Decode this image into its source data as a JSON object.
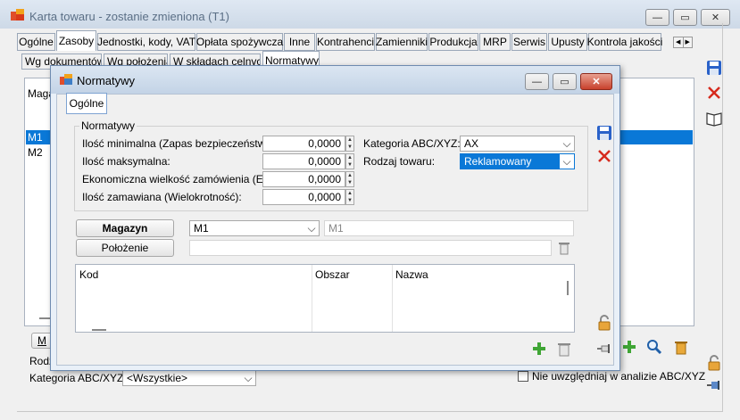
{
  "outer": {
    "title": "Karta towaru - zostanie zmieniona (T1)",
    "tabs": [
      "Ogólne",
      "Zasoby",
      "Jednostki, kody, VAT",
      "Opłata spożywcza",
      "Inne",
      "Kontrahenci",
      "Zamienniki",
      "Produkcja",
      "MRP",
      "Serwis",
      "Upusty",
      "Kontrola jakości"
    ],
    "active_tab": "Zasoby",
    "subtabs": [
      "Wg dokumentów",
      "Wg położenia",
      "W składach celnych",
      "Normatywy"
    ],
    "active_subtab": "Normatywy",
    "list_header": "Magazyn",
    "list_rows": [
      "M1",
      "M2"
    ],
    "selected_row": "M1",
    "bottom_button_label": "M",
    "rodz_label": "Rodz",
    "kategoria_label": "Kategoria ABC/XYZ:",
    "kategoria_value": "<Wszystkie>",
    "exclude_checkbox_label": "Nie uwzględniaj w analizie ABC/XYZ",
    "exclude_checked": false
  },
  "dialog": {
    "title": "Normatywy",
    "tab": "Ogólne",
    "group_title": "Normatywy",
    "fields": [
      {
        "label": "Ilość minimalna (Zapas bezpieczeństwa):",
        "value": "0,0000"
      },
      {
        "label": "Ilość maksymalna:",
        "value": "0,0000"
      },
      {
        "label": "Ekonomiczna wielkość zamówienia (EOQ):",
        "value": "0,0000"
      },
      {
        "label": "Ilość zamawiana (Wielokrotność):",
        "value": "0,0000"
      }
    ],
    "kategoria_label": "Kategoria ABC/XYZ:",
    "kategoria_value": "AX",
    "rodzaj_label": "Rodzaj towaru:",
    "rodzaj_value": "Reklamowany",
    "magazyn_button": "Magazyn",
    "magazyn_value": "M1",
    "magazyn_name": "M1",
    "polozenie_button": "Położenie",
    "polozenie_value": "",
    "table_columns": [
      "Kod",
      "Obszar",
      "Nazwa"
    ]
  },
  "colors": {
    "selection": "#0a78d7",
    "save": "#2a62c9",
    "delete": "#d62a1d",
    "add": "#3fa535"
  },
  "icons": [
    "app-icon",
    "minimize-icon",
    "maximize-icon",
    "close-icon",
    "save-icon",
    "delete-icon",
    "book-icon",
    "lock-icon",
    "pin-icon",
    "add-icon",
    "trash-icon",
    "search-icon",
    "chevron-down-icon"
  ]
}
